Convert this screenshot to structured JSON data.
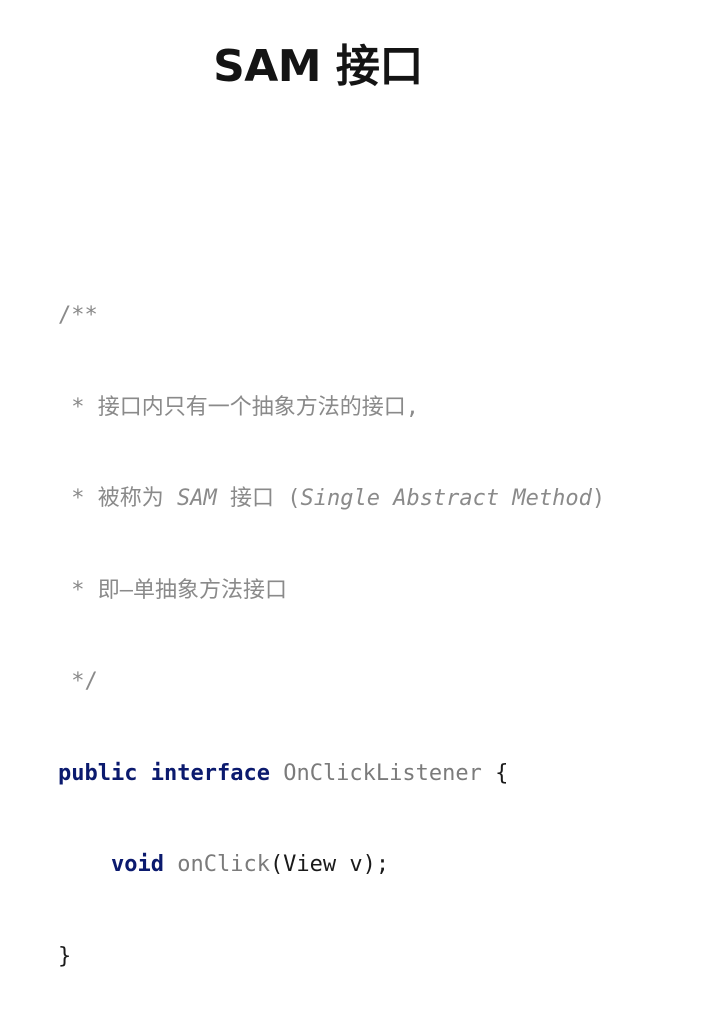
{
  "slide": {
    "title": "SAM 接口"
  },
  "code": {
    "comment_open": "/**",
    "comment_line1": " * 接口内只有一个抽象方法的接口,",
    "comment_line2_prefix": " * 被称为 ",
    "comment_line2_sam": "SAM",
    "comment_line2_mid": " 接口 (",
    "comment_line2_term": "Single Abstract Method",
    "comment_line2_close": ")",
    "comment_line3": " * 即—单抽象方法接口",
    "comment_close": " */",
    "kw_public": "public",
    "kw_interface": "interface",
    "interface_name": "OnClickListener",
    "brace_open": " {",
    "indent": "    ",
    "kw_void": "void",
    "method_name": "onClick",
    "method_params": "(View v);",
    "brace_close": "}"
  }
}
